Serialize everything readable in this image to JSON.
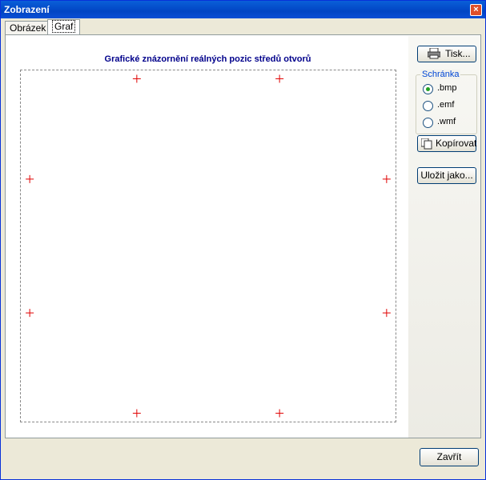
{
  "window": {
    "title": "Zobrazení"
  },
  "tabs": [
    {
      "label": "Obrázek"
    },
    {
      "label": "Graf"
    }
  ],
  "graph": {
    "title": "Grafické znázornění reálných pozic středů otvorů"
  },
  "side": {
    "print_label": "Tisk...",
    "clipboard_label": "Schránka",
    "formats": [
      ".bmp",
      ".emf",
      ".wmf"
    ],
    "selected_format": ".bmp",
    "copy_label": "Kopírovat",
    "save_label": "Uložit jako..."
  },
  "footer": {
    "close_label": "Zavřít"
  },
  "icons": {
    "print": "printer-icon",
    "copy": "copy-icon",
    "close": "close-icon"
  },
  "colors": {
    "marker": "#e00000",
    "title": "#00008b"
  },
  "chart_data": {
    "type": "scatter",
    "title": "Grafické znázornění reálných pozic středů otvorů",
    "points": [
      {
        "x": -0.4,
        "y": 1.0
      },
      {
        "x": 0.4,
        "y": 1.0
      },
      {
        "x": -1.0,
        "y": 0.4
      },
      {
        "x": 1.0,
        "y": 0.4
      },
      {
        "x": -1.0,
        "y": -0.4
      },
      {
        "x": 1.0,
        "y": -0.4
      },
      {
        "x": -0.4,
        "y": -1.0
      },
      {
        "x": 0.4,
        "y": -1.0
      }
    ],
    "marker": "+",
    "xlim": [
      -1.05,
      1.05
    ],
    "ylim": [
      -1.05,
      1.05
    ]
  }
}
